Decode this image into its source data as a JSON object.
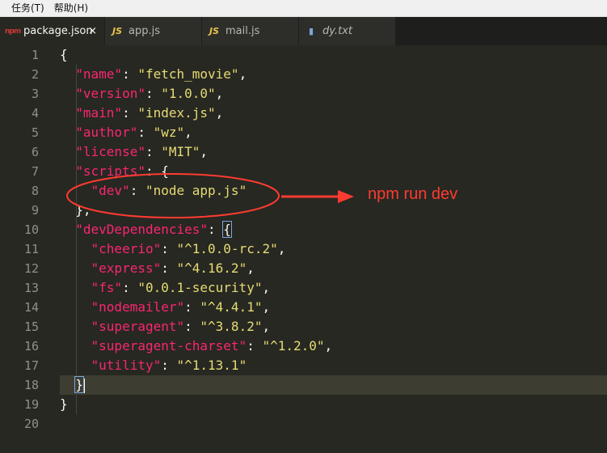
{
  "menu": [
    "任务(T)",
    "帮助(H)"
  ],
  "tabs": [
    {
      "label": "package.json",
      "icon": "npm-icon",
      "glyph": "npm",
      "active": true,
      "italic": false,
      "close": "×"
    },
    {
      "label": "app.js",
      "icon": "js-icon",
      "glyph": "JS",
      "active": false,
      "italic": false
    },
    {
      "label": "mail.js",
      "icon": "js-icon",
      "glyph": "JS",
      "active": false,
      "italic": false
    },
    {
      "label": "dy.txt",
      "icon": "file-icon",
      "glyph": "▮",
      "active": false,
      "italic": true
    }
  ],
  "editor": {
    "line_numbers": [
      "1",
      "2",
      "3",
      "4",
      "5",
      "6",
      "7",
      "8",
      "9",
      "10",
      "11",
      "12",
      "13",
      "14",
      "15",
      "16",
      "17",
      "18",
      "19",
      "20"
    ],
    "current_line": 18,
    "lines": [
      [
        [
          "p",
          "{"
        ]
      ],
      [
        [
          "p",
          "  "
        ],
        [
          "k",
          "\"name\""
        ],
        [
          "p",
          ": "
        ],
        [
          "s",
          "\"fetch_movie\""
        ],
        [
          "p",
          ","
        ]
      ],
      [
        [
          "p",
          "  "
        ],
        [
          "k",
          "\"version\""
        ],
        [
          "p",
          ": "
        ],
        [
          "s",
          "\"1.0.0\""
        ],
        [
          "p",
          ","
        ]
      ],
      [
        [
          "p",
          "  "
        ],
        [
          "k",
          "\"main\""
        ],
        [
          "p",
          ": "
        ],
        [
          "s",
          "\"index.js\""
        ],
        [
          "p",
          ","
        ]
      ],
      [
        [
          "p",
          "  "
        ],
        [
          "k",
          "\"author\""
        ],
        [
          "p",
          ": "
        ],
        [
          "s",
          "\"wz\""
        ],
        [
          "p",
          ","
        ]
      ],
      [
        [
          "p",
          "  "
        ],
        [
          "k",
          "\"license\""
        ],
        [
          "p",
          ": "
        ],
        [
          "s",
          "\"MIT\""
        ],
        [
          "p",
          ","
        ]
      ],
      [
        [
          "p",
          "  "
        ],
        [
          "k",
          "\"scripts\""
        ],
        [
          "p",
          ": {"
        ]
      ],
      [
        [
          "p",
          "    "
        ],
        [
          "k",
          "\"dev\""
        ],
        [
          "p",
          ": "
        ],
        [
          "s",
          "\"node app.js\""
        ]
      ],
      [
        [
          "p",
          "  },"
        ]
      ],
      [
        [
          "p",
          "  "
        ],
        [
          "k",
          "\"devDependencies\""
        ],
        [
          "p",
          ": "
        ],
        [
          "b",
          "{"
        ]
      ],
      [
        [
          "p",
          "    "
        ],
        [
          "k",
          "\"cheerio\""
        ],
        [
          "p",
          ": "
        ],
        [
          "s",
          "\"^1.0.0-rc.2\""
        ],
        [
          "p",
          ","
        ]
      ],
      [
        [
          "p",
          "    "
        ],
        [
          "k",
          "\"express\""
        ],
        [
          "p",
          ": "
        ],
        [
          "s",
          "\"^4.16.2\""
        ],
        [
          "p",
          ","
        ]
      ],
      [
        [
          "p",
          "    "
        ],
        [
          "k",
          "\"fs\""
        ],
        [
          "p",
          ": "
        ],
        [
          "s",
          "\"0.0.1-security\""
        ],
        [
          "p",
          ","
        ]
      ],
      [
        [
          "p",
          "    "
        ],
        [
          "k",
          "\"nodemailer\""
        ],
        [
          "p",
          ": "
        ],
        [
          "s",
          "\"^4.4.1\""
        ],
        [
          "p",
          ","
        ]
      ],
      [
        [
          "p",
          "    "
        ],
        [
          "k",
          "\"superagent\""
        ],
        [
          "p",
          ": "
        ],
        [
          "s",
          "\"^3.8.2\""
        ],
        [
          "p",
          ","
        ]
      ],
      [
        [
          "p",
          "    "
        ],
        [
          "k",
          "\"superagent-charset\""
        ],
        [
          "p",
          ": "
        ],
        [
          "s",
          "\"^1.2.0\""
        ],
        [
          "p",
          ","
        ]
      ],
      [
        [
          "p",
          "    "
        ],
        [
          "k",
          "\"utility\""
        ],
        [
          "p",
          ": "
        ],
        [
          "s",
          "\"^1.13.1\""
        ]
      ],
      [
        [
          "p",
          "  "
        ],
        [
          "b",
          "}"
        ]
      ],
      [
        [
          "p",
          "}"
        ]
      ],
      []
    ]
  },
  "annotation": {
    "text": "npm run dev",
    "color": "#ff3b30"
  },
  "colors": {
    "background": "#272822",
    "key": "#f92672",
    "string": "#e6db74",
    "punctuation": "#f8f8f2",
    "line_number": "#90908a"
  }
}
